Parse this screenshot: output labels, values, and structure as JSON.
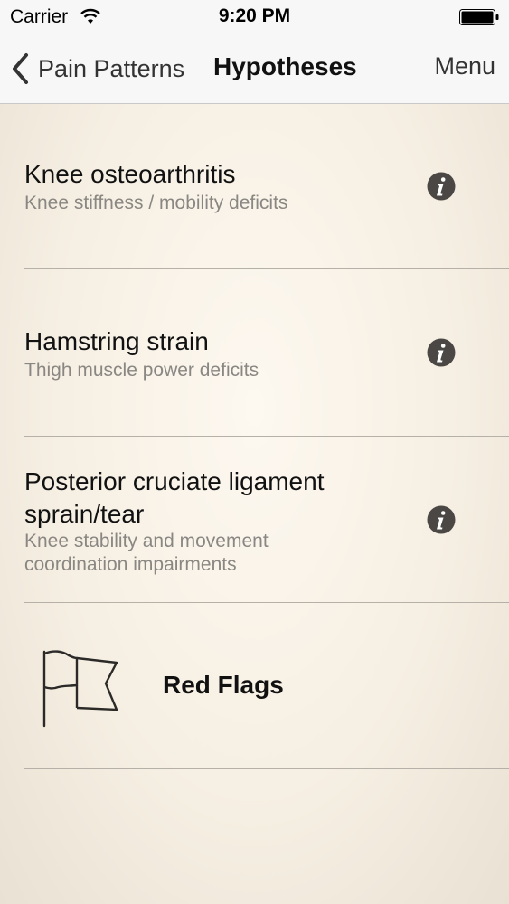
{
  "status_bar": {
    "carrier": "Carrier",
    "time": "9:20 PM"
  },
  "nav": {
    "back_label": "Pain Patterns",
    "title": "Hypotheses",
    "menu_label": "Menu"
  },
  "hypotheses": [
    {
      "title": "Knee osteoarthritis",
      "subtitle": "Knee stiffness / mobility deficits"
    },
    {
      "title": "Hamstring strain",
      "subtitle": "Thigh muscle power deficits"
    },
    {
      "title": "Posterior cruciate ligament sprain/tear",
      "subtitle": "Knee stability and movement coordination impairments"
    }
  ],
  "red_flags": {
    "label": "Red Flags"
  },
  "icons": {
    "info": "info-icon",
    "flag": "flag-icon",
    "back": "chevron-left-icon",
    "wifi": "wifi-icon",
    "battery": "battery-icon"
  },
  "colors": {
    "background": "#f6efe3",
    "subtitle": "#8a8783",
    "info_icon": "#4a4744"
  }
}
